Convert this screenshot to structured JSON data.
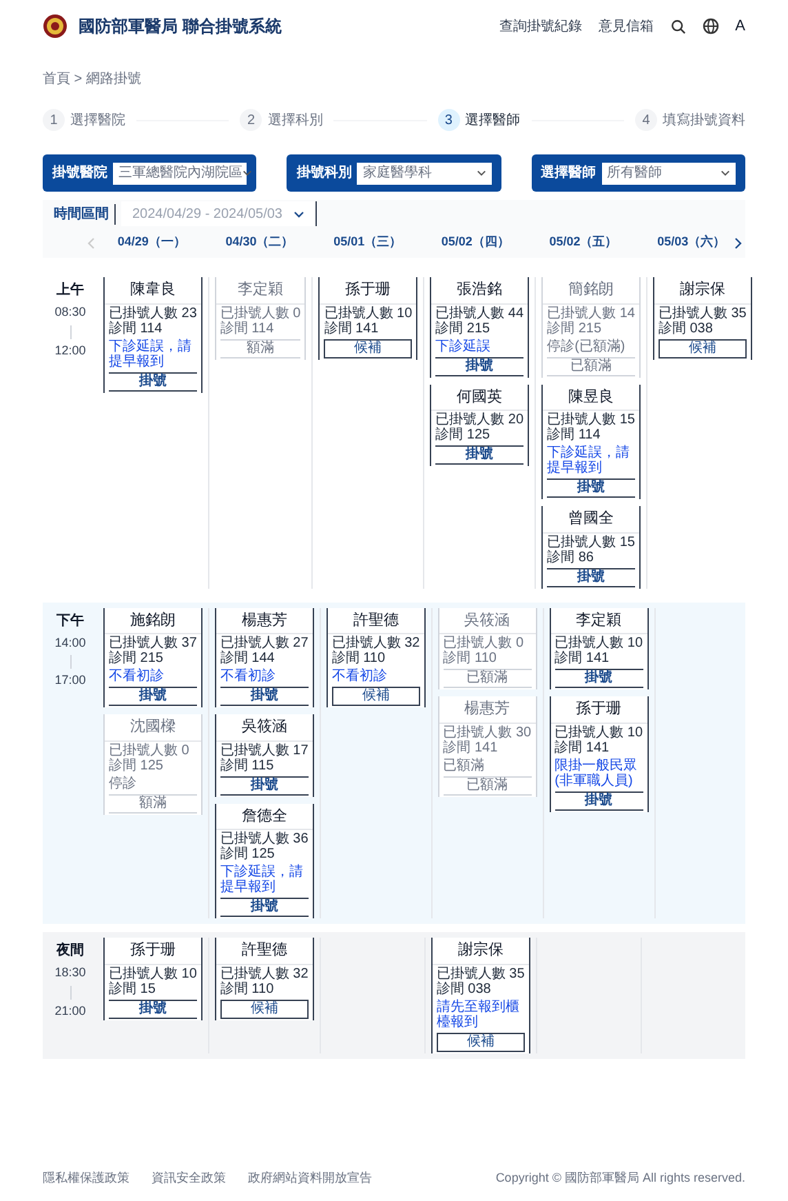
{
  "header": {
    "title": "國防部軍醫局 聯合掛號系統",
    "nav": [
      "查詢掛號紀錄",
      "意見信箱"
    ],
    "font_toggle": "A"
  },
  "breadcrumb": "首頁 > 網路掛號",
  "steps": [
    {
      "number": "1",
      "label": "選擇醫院",
      "selected": false
    },
    {
      "number": "2",
      "label": "選擇科別",
      "selected": false
    },
    {
      "number": "3",
      "label": "選擇醫師",
      "selected": true
    },
    {
      "number": "4",
      "label": "填寫掛號資料",
      "selected": false
    }
  ],
  "filters": [
    {
      "label": "掛號醫院",
      "placeholder": "三軍總醫院內湖院區"
    },
    {
      "label": "掛號科別",
      "placeholder": "家庭醫學科"
    },
    {
      "label": "選擇醫師",
      "placeholder": "所有醫師"
    }
  ],
  "date_range": {
    "label": "時間區間",
    "value": "2024/04/29 - 2024/05/03"
  },
  "days": [
    "04/29（一）",
    "04/30（二）",
    "05/01（三）",
    "05/02（四）",
    "05/02（五）",
    "05/03（六）"
  ],
  "sessions": [
    {
      "kind": "morning",
      "label": "上午",
      "start": "08:30",
      "end": "12:00",
      "columns": [
        [
          {
            "name": "陳韋良",
            "count": "已掛號人數 23",
            "room": "診間 114",
            "note": "下診延誤，請提早報到",
            "kind": "open",
            "button": "掛號"
          }
        ],
        [
          {
            "name": "李定穎",
            "count": "已掛號人數 0",
            "room": "診間 114",
            "kind": "full",
            "button": "額滿"
          }
        ],
        [
          {
            "name": "孫于珊",
            "count": "已掛號人數 10",
            "room": "診間 141",
            "kind": "waitlist",
            "button": "候補"
          }
        ],
        [
          {
            "name": "張浩銘",
            "count": "已掛號人數 44",
            "room": "診間 215",
            "note": "下診延誤",
            "kind": "open",
            "button": "掛號"
          },
          {
            "name": "何國英",
            "count": "已掛號人數 20",
            "room": "診間 125",
            "kind": "open",
            "button": "掛號"
          }
        ],
        [
          {
            "name": "簡銘朗",
            "count": "已掛號人數 14",
            "room": "診間 215",
            "note": "停診(已額滿)",
            "kind": "full",
            "button": "已額滿"
          },
          {
            "name": "陳昱良",
            "count": "已掛號人數 15",
            "room": "診間 114",
            "note": "下診延誤，請提早報到",
            "kind": "open",
            "button": "掛號"
          },
          {
            "name": "曾國全",
            "count": "已掛號人數 15",
            "room": "診間 86",
            "kind": "open",
            "button": "掛號"
          }
        ],
        [
          {
            "name": "謝宗保",
            "count": "已掛號人數 35",
            "room": "診間 038",
            "kind": "waitlist",
            "button": "候補"
          }
        ]
      ]
    },
    {
      "kind": "afternoon",
      "label": "下午",
      "start": "14:00",
      "end": "17:00",
      "columns": [
        [
          {
            "name": "施銘朗",
            "count": "已掛號人數 37",
            "room": "診間 215",
            "note": "不看初診",
            "kind": "open",
            "button": "掛號"
          },
          {
            "name": "沈國樑",
            "count": "已掛號人數 0",
            "room": "診間 125",
            "note": "停診",
            "kind": "full",
            "button": "額滿"
          }
        ],
        [
          {
            "name": "楊惠芳",
            "count": "已掛號人數 27",
            "room": "診間 144",
            "note": "不看初診",
            "kind": "open",
            "button": "掛號"
          },
          {
            "name": "吳筱涵",
            "count": "已掛號人數 17",
            "room": "診間 115",
            "kind": "open",
            "button": "掛號"
          },
          {
            "name": "詹德全",
            "count": "已掛號人數 36",
            "room": "診間 125",
            "note": "下診延誤，請提早報到",
            "kind": "open",
            "button": "掛號"
          }
        ],
        [
          {
            "name": "許聖德",
            "count": "已掛號人數 32",
            "room": "診間 110",
            "note": "不看初診",
            "kind": "waitlist",
            "button": "候補"
          }
        ],
        [
          {
            "name": "吳筱涵",
            "count": "已掛號人數 0",
            "room": "診間 110",
            "kind": "full",
            "button": "已額滿"
          },
          {
            "name": "楊惠芳",
            "count": "已掛號人數 30",
            "room": "診間 141",
            "note": "已額滿",
            "kind": "full",
            "button": "已額滿"
          }
        ],
        [
          {
            "name": "李定穎",
            "count": "已掛號人數 10",
            "room": "診間 141",
            "kind": "open",
            "button": "掛號"
          },
          {
            "name": "孫于珊",
            "count": "已掛號人數 10",
            "room": "診間 141",
            "note": "限掛一般民眾(非軍職人員)",
            "kind": "open",
            "button": "掛號"
          }
        ],
        []
      ]
    },
    {
      "kind": "night",
      "label": "夜間",
      "start": "18:30",
      "end": "21:00",
      "columns": [
        [
          {
            "name": "孫于珊",
            "count": "已掛號人數 10",
            "room": "診間 15",
            "kind": "open",
            "button": "掛號"
          }
        ],
        [
          {
            "name": "許聖德",
            "count": "已掛號人數 32",
            "room": "診間 110",
            "kind": "waitlist",
            "button": "候補"
          }
        ],
        [],
        [
          {
            "name": "謝宗保",
            "count": "已掛號人數 35",
            "room": "診間 038",
            "note": "請先至報到櫃檯報到",
            "kind": "waitlist",
            "button": "候補"
          }
        ],
        [],
        []
      ]
    }
  ],
  "footer": {
    "links": [
      "隱私權保護政策",
      "資訊安全政策",
      "政府網站資料開放宣告"
    ],
    "copyright": "Copyright © 國防部軍醫局 All rights reserved."
  }
}
